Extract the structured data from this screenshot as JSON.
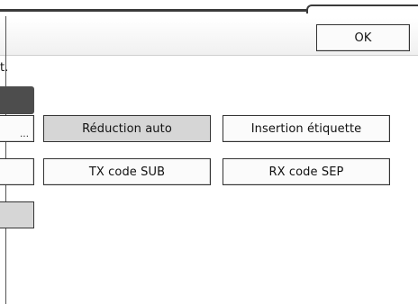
{
  "header": {
    "ok_label": "OK"
  },
  "instruction_text": "t.",
  "left_column": {
    "first_button_suffix": "..."
  },
  "options": [
    {
      "label": "Réduction auto",
      "selected": true
    },
    {
      "label": "Insertion étiquette",
      "selected": false
    },
    {
      "label": "TX code SUB",
      "selected": false
    },
    {
      "label": "RX code SEP",
      "selected": false
    }
  ]
}
